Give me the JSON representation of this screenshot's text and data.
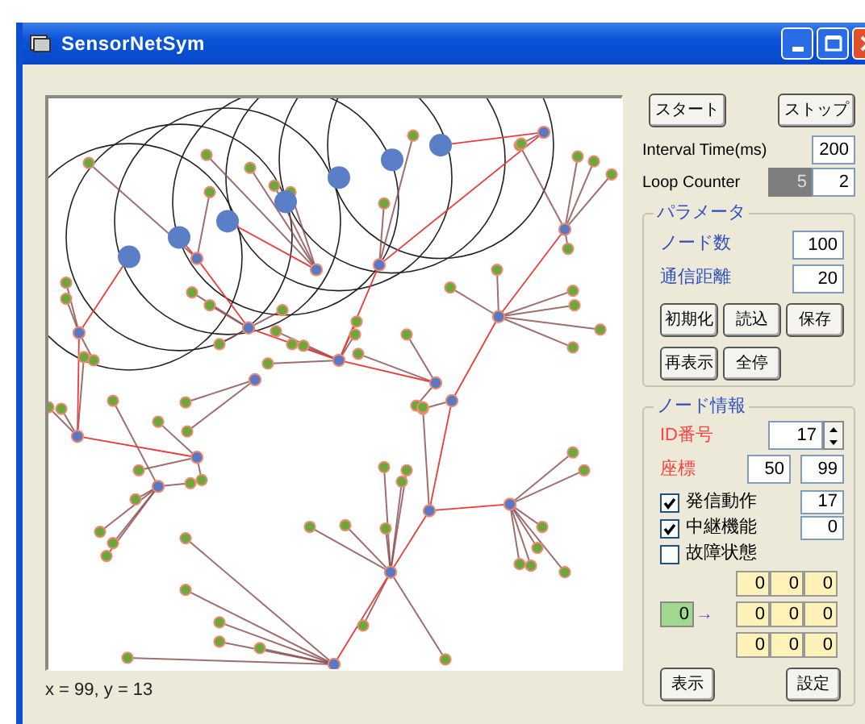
{
  "window": {
    "title": "SensorNetSym"
  },
  "controls": {
    "start_button": "スタート",
    "stop_button": "ストップ",
    "interval": {
      "label": "Interval Time(ms)",
      "value": "200"
    },
    "loop_counter": {
      "label": "Loop Counter",
      "values": [
        "5",
        "2"
      ]
    }
  },
  "parameters": {
    "title": "パラメータ",
    "fields": [
      {
        "label": "ノード数",
        "value": "100"
      },
      {
        "label": "通信距離",
        "value": "20"
      }
    ],
    "buttons": [
      "初期化",
      "読込",
      "保存",
      "再表示",
      "全停"
    ]
  },
  "node_info": {
    "title": "ノード情報",
    "id": {
      "label": "ID番号",
      "value": "17"
    },
    "coordinates": {
      "label": "座標",
      "values": [
        "50",
        "99"
      ]
    },
    "flags": [
      {
        "label": "発信動作",
        "checked": true,
        "value": "17"
      },
      {
        "label": "中継機能",
        "checked": true,
        "value": "0"
      },
      {
        "label": "故障状態",
        "checked": false
      }
    ],
    "routing": {
      "source": "0",
      "arrow": "→",
      "table": [
        [
          "0",
          "0",
          "0"
        ],
        [
          "0",
          "0",
          "0"
        ],
        [
          "0",
          "0",
          "0"
        ]
      ]
    },
    "buttons": [
      "表示",
      "設定"
    ]
  },
  "status": "x = 99, y = 13"
}
